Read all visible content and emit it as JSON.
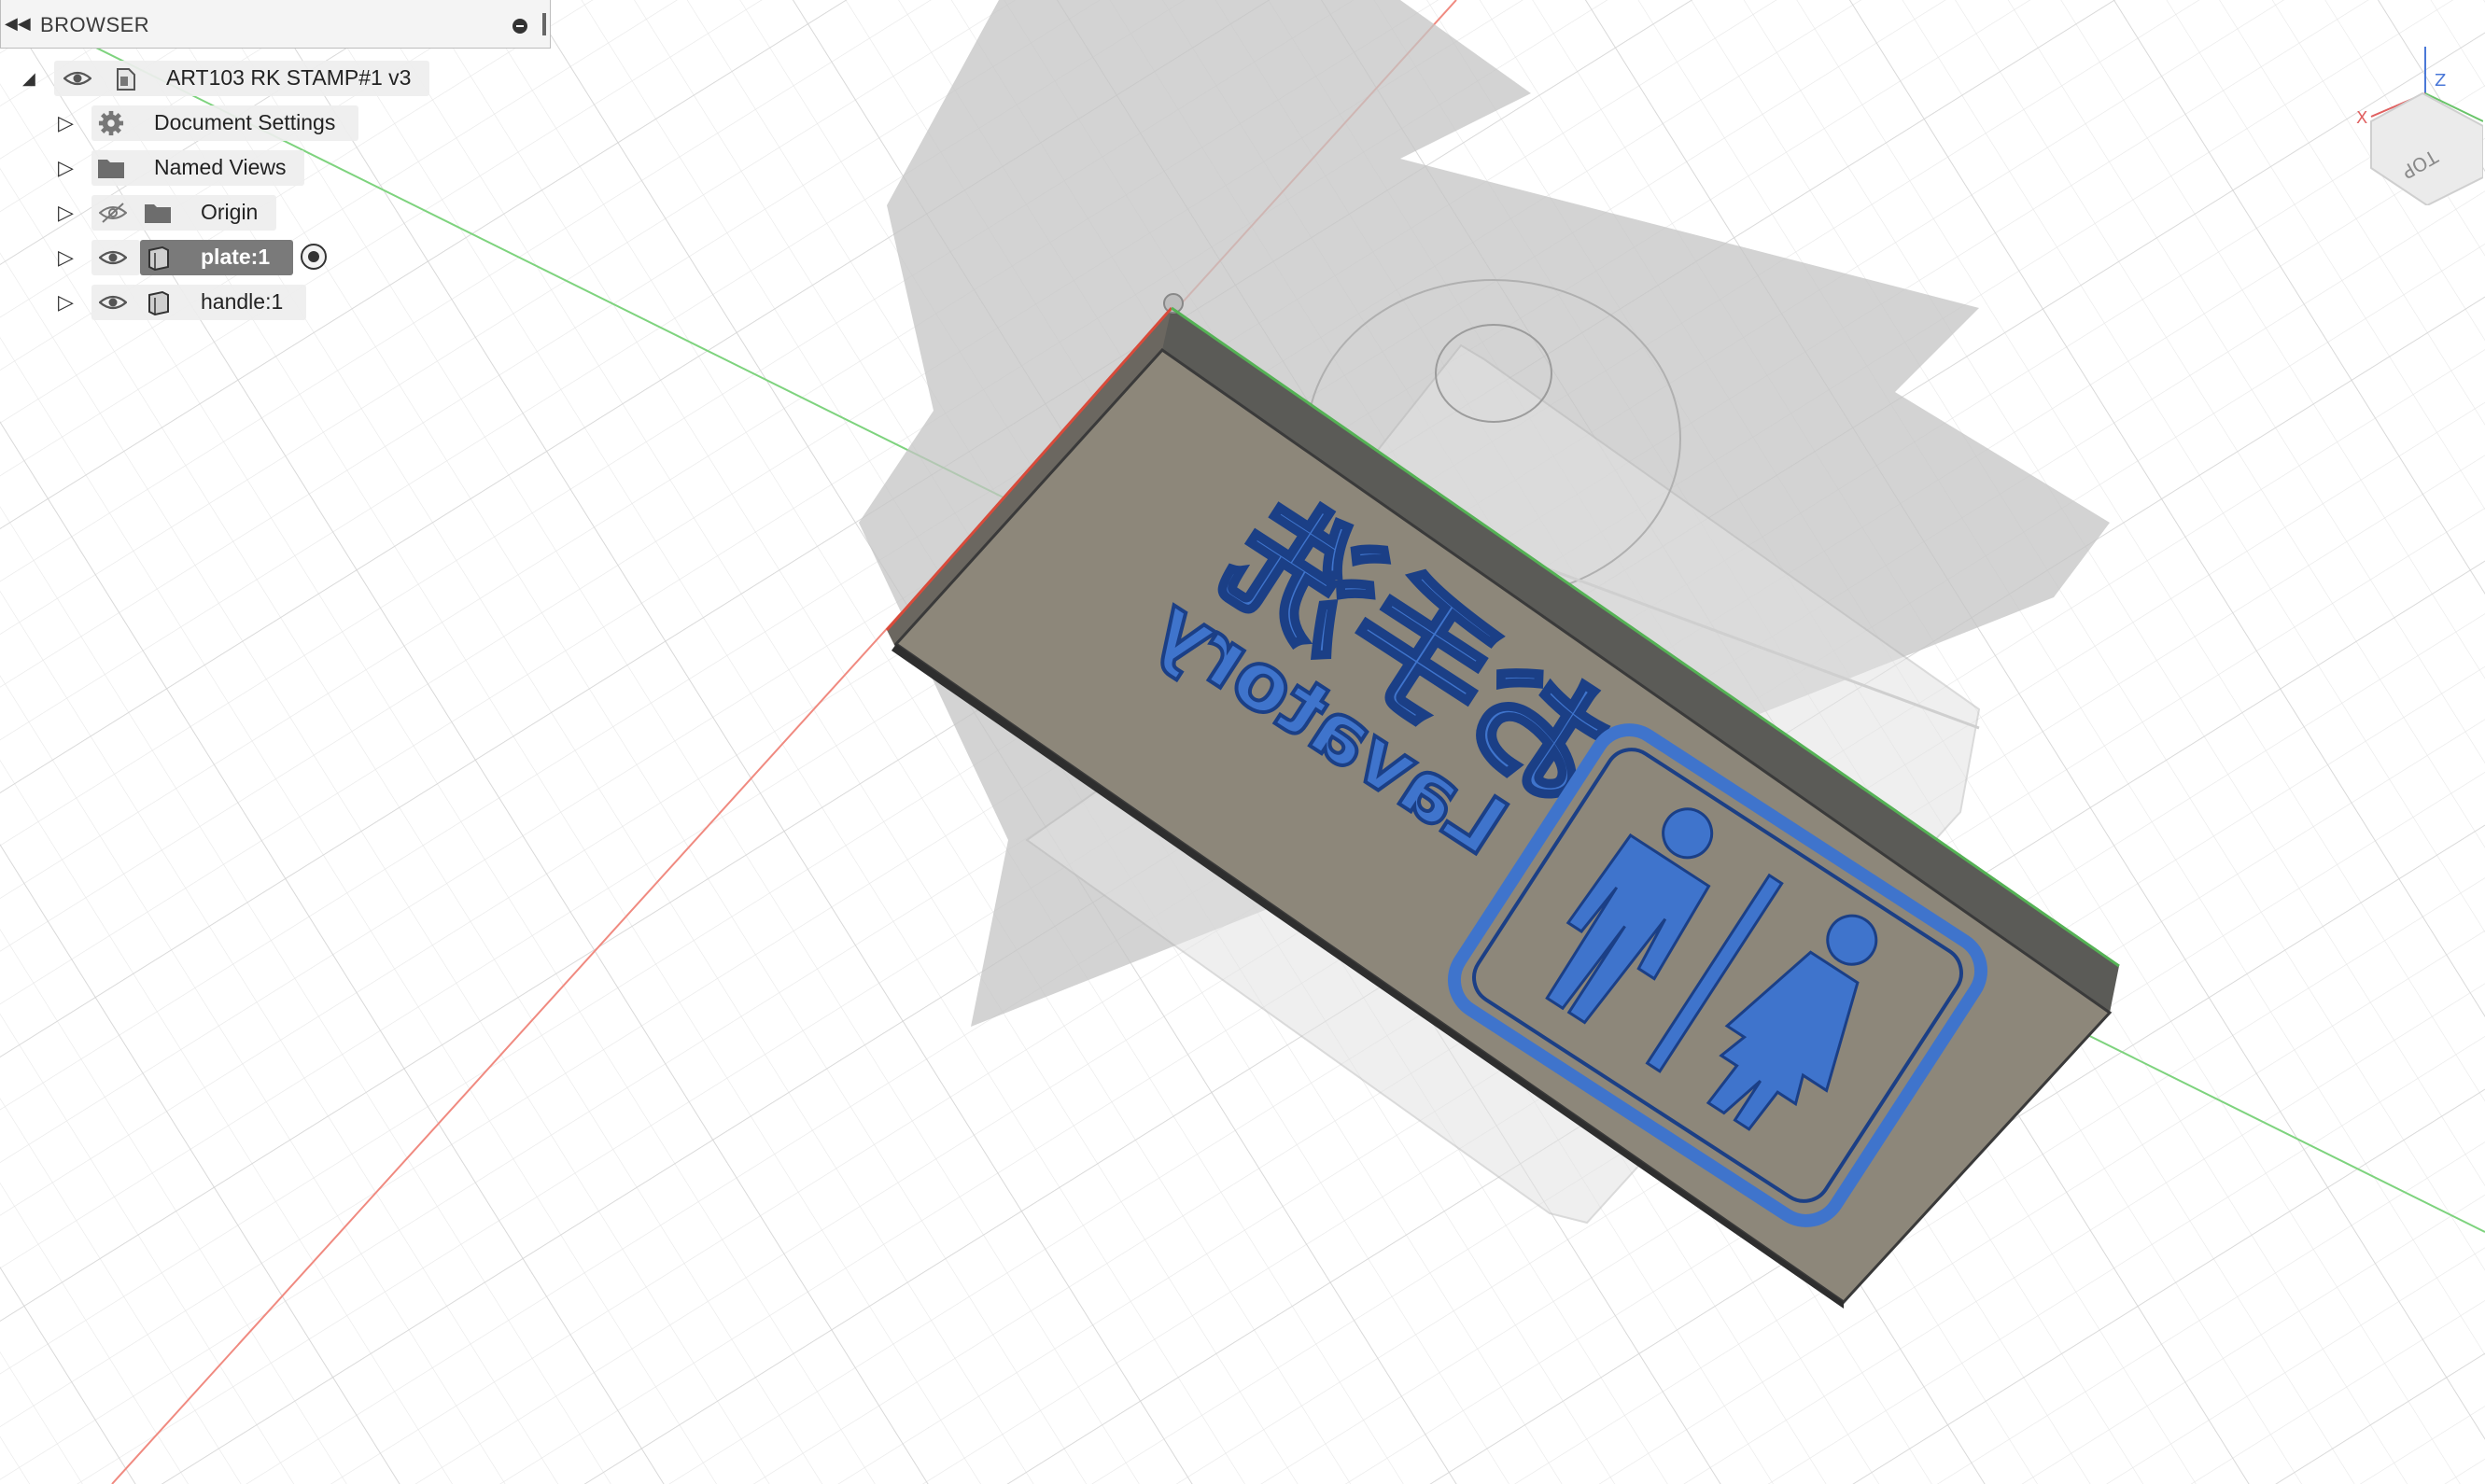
{
  "browser": {
    "title": "BROWSER",
    "root": {
      "label": "ART103 RK STAMP#1 v3"
    },
    "items": [
      {
        "label": "Document Settings",
        "icon": "gear-icon"
      },
      {
        "label": "Named Views",
        "icon": "folder-icon"
      },
      {
        "label": "Origin",
        "icon": "folder-icon",
        "visibility": "hidden"
      },
      {
        "label": "plate:1",
        "icon": "body-icon",
        "visibility": "visible",
        "selected": true,
        "activated": true
      },
      {
        "label": "handle:1",
        "icon": "body-icon",
        "visibility": "visible"
      }
    ]
  },
  "viewcube": {
    "face": "TOP",
    "x_axis": "X",
    "z_axis": "Z"
  },
  "stamp": {
    "japanese_text": "お手洗",
    "english_text": "Lavatory"
  },
  "colors": {
    "plate_face": "#8d877a",
    "relief_blue": "#3f74cc",
    "x_axis": "#e06a60",
    "y_axis": "#56c256",
    "selection": "#7a7a7a"
  }
}
